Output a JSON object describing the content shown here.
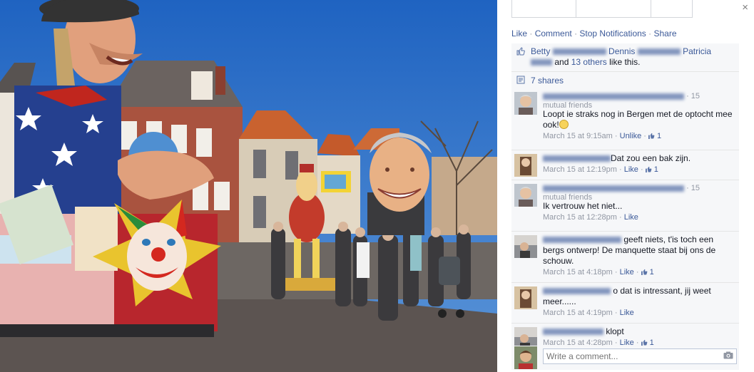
{
  "close_label": "×",
  "actions": {
    "like": "Like",
    "comment": "Comment",
    "stop_notifications": "Stop Notifications",
    "share": "Share",
    "sep": "·"
  },
  "likes": {
    "first": "Betty",
    "second": "Dennis",
    "third": "Patricia",
    "and_text": "and",
    "others": "13 others",
    "suffix": "like this."
  },
  "shares": {
    "label": "7 shares"
  },
  "comments": [
    {
      "head_suffix": "· 15",
      "head_sub": "mutual friends",
      "text": "Loopt ie straks nog in Bergen met de optocht mee ook!",
      "has_emoji": true,
      "time": "March 15 at 9:15am",
      "action": "Unlike",
      "likes": "1"
    },
    {
      "text": "Dat zou een bak zijn.",
      "time": "March 15 at 12:19pm",
      "action": "Like",
      "likes": "1"
    },
    {
      "head_suffix": "· 15",
      "head_sub": "mutual friends",
      "text": "Ik vertrouw het niet...",
      "time": "March 15 at 12:28pm",
      "action": "Like"
    },
    {
      "text": "geeft niets, t'is toch een bergs ontwerp! De manquette staat bij ons de schouw.",
      "time": "March 15 at 4:18pm",
      "action": "Like",
      "likes": "1"
    },
    {
      "text": "o dat is intressant, jij weet meer......",
      "time": "March 15 at 4:19pm",
      "action": "Like"
    },
    {
      "text": "klopt",
      "time": "March 15 at 4:28pm",
      "action": "Like",
      "likes": "1"
    }
  ],
  "write_comment": {
    "placeholder": "Write a comment..."
  },
  "colors": {
    "link": "#3b5998",
    "meta": "#9197a3",
    "panel": "#f6f7f9",
    "sky": "#2e74c9"
  },
  "icons": [
    "close-icon",
    "thumbs-up-icon",
    "shares-icon",
    "camera-icon",
    "smiley-emoji-icon"
  ]
}
